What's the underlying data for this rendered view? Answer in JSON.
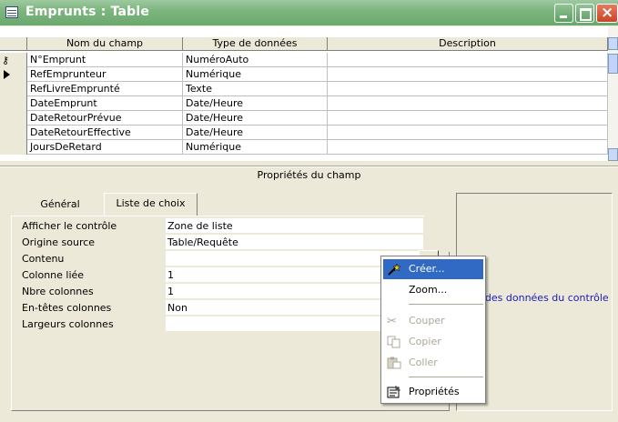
{
  "window": {
    "title": "Emprunts : Table",
    "title_bar_color": "#7db67f"
  },
  "grid": {
    "columns": [
      "Nom du champ",
      "Type de données",
      "Description"
    ],
    "rows": [
      {
        "name": "N°Emprunt",
        "type": "NuméroAuto",
        "description": "",
        "marker": "key-icon"
      },
      {
        "name": "RefEmprunteur",
        "type": "Numérique",
        "description": "",
        "marker": "current-row-arrow-icon"
      },
      {
        "name": "RefLivreEmprunté",
        "type": "Texte",
        "description": "",
        "marker": ""
      },
      {
        "name": "DateEmprunt",
        "type": "Date/Heure",
        "description": "",
        "marker": ""
      },
      {
        "name": "DateRetourPrévue",
        "type": "Date/Heure",
        "description": "",
        "marker": ""
      },
      {
        "name": "DateRetourEffective",
        "type": "Date/Heure",
        "description": "",
        "marker": ""
      },
      {
        "name": "JoursDeRetard",
        "type": "Numérique",
        "description": "",
        "marker": ""
      }
    ]
  },
  "properties": {
    "title": "Propriétés du champ",
    "tabs": [
      "Général",
      "Liste de choix"
    ],
    "active_tab": "Liste de choix",
    "rows": [
      {
        "label": "Afficher le contrôle",
        "value": "Zone de liste"
      },
      {
        "label": "Origine source",
        "value": "Table/Requête"
      },
      {
        "label": "Contenu",
        "value": ""
      },
      {
        "label": "Colonne liée",
        "value": "1"
      },
      {
        "label": "Nbre colonnes",
        "value": "1"
      },
      {
        "label": "En-têtes colonnes",
        "value": "Non"
      },
      {
        "label": "Largeurs colonnes",
        "value": ""
      }
    ],
    "help_text": "Source des données du contrôle",
    "help_text_visible": "urce des données du contrôle"
  },
  "context_menu": {
    "items": [
      {
        "label": "Créer...",
        "icon": "wand-icon",
        "state": "highlighted"
      },
      {
        "label": "Zoom...",
        "icon": "",
        "state": "enabled"
      },
      {
        "label": "Couper",
        "icon": "scissors-icon",
        "state": "disabled"
      },
      {
        "label": "Copier",
        "icon": "copy-icon",
        "state": "disabled"
      },
      {
        "label": "Coller",
        "icon": "paste-icon",
        "state": "disabled"
      },
      {
        "label": "Propriétés",
        "icon": "properties-icon",
        "state": "enabled"
      }
    ]
  },
  "colors": {
    "highlight": "#316ac5",
    "help_text": "#1b1bb8",
    "face": "#ece9d8"
  }
}
